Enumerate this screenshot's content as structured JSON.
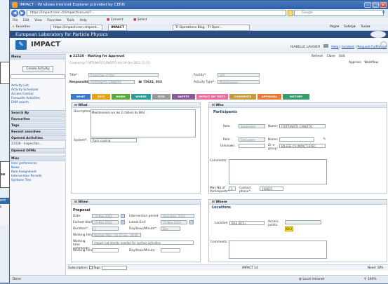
{
  "background": {
    "left_box_label": "se",
    "bottom_label": "ent fe",
    "bottom_row": "k",
    "bottom_btn": "View"
  },
  "window": {
    "title": "IMPACT - Windows Internet Explorer provided by CERN",
    "min": "–",
    "max": "□",
    "close": "✕"
  },
  "nav": {
    "back": "◀",
    "forward": "▶",
    "url": "https://impact.cern.ch/impact/secure/?...",
    "search_placeholder": "Google"
  },
  "menu": [
    "File",
    "Edit",
    "View",
    "Favorites",
    "Tools",
    "Help"
  ],
  "menu_extra": {
    "convert": "Convert",
    "select": "Select"
  },
  "favorites": {
    "label": "Favorites",
    "tab1": "https://impact.cern.ch/perd...",
    "tab2": "IMPACT",
    "tab3": "TI Operations Blog - TI Oper..."
  },
  "toolbar_right": {
    "page": "Page",
    "safety": "Safety",
    "tools": "Tools"
  },
  "banner": "European Laboratory for Particle Physics",
  "app": {
    "name": "IMPACT",
    "user": "ISABELLE LAUGIER",
    "help": "Help",
    "incident": "Incident",
    "request": "Request Fulfilment"
  },
  "sidebar": {
    "menu_title": "Menu",
    "create": "Create Activity",
    "links1": [
      "Activity List",
      "Activity Scheduler",
      "Access Control",
      "Favourite Activities",
      "EAM search"
    ],
    "search_by": "Search By",
    "favourites": "Favourites",
    "tags": "Tags",
    "recent": "Recent searches",
    "opened_act": "Opened Activities",
    "opened_item": "21528 - Inspection...",
    "opened_ofs": "Opened OFMs",
    "misc": "Misc",
    "links2": [
      "User preferences",
      "News",
      "Role Assignment",
      "Intervention Periods",
      "Systems Tree"
    ]
  },
  "activity": {
    "breadcrumb": "21528 - Waiting for Approval",
    "created": "Created by FORTUNATO CANDITO the 29-Oct-2012 11:15",
    "refresh": "Refresh",
    "clone": "Clone",
    "edit": "Edit",
    "approve": "Approve",
    "workflow": "Workflow",
    "title_lbl": "Title*:",
    "title_val": "Inspection chiller",
    "facility_lbl": "Facility*:",
    "facility_val": "SPS",
    "resp_lbl": "Responsible*:",
    "resp_val": "FORTUNATO CANDITO",
    "phone": "75622, 933",
    "acttype_lbl": "Activity Type*:",
    "acttype_val": "Maintenance",
    "collapse": "Collapse All"
  },
  "tabs": [
    {
      "label": "WHAT",
      "color": "#3c78c8"
    },
    {
      "label": "WHO",
      "color": "#e8a21a"
    },
    {
      "label": "WHEN",
      "color": "#5caa3c"
    },
    {
      "label": "WHERE",
      "color": "#2f9c98"
    },
    {
      "label": "RISK",
      "color": "#9a9a9a"
    },
    {
      "label": "SAFETY",
      "color": "#8a5a9a"
    },
    {
      "label": "IMPACT ON TESTS",
      "color": "#e86aa0"
    },
    {
      "label": "COMMENTS",
      "color": "#c89a3a"
    },
    {
      "label": "APPROVAL",
      "color": "#e87a3a"
    },
    {
      "label": "HISTORY",
      "color": "#3a9a6a"
    }
  ],
  "what": {
    "title": "What",
    "desc_lbl": "Description:",
    "desc_val": "Maintenance sur les 2 chillers du BA3 .",
    "system_lbl": "System*:",
    "system_val": "Rack cooling"
  },
  "who": {
    "title": "Who",
    "participants": "Participants",
    "role_lbl": "Role:",
    "role1": "Supervisor",
    "name_lbl": "Name:",
    "name1": "FORTUNATO CANDITO",
    "role2": "Executant",
    "unknown_lbl": "Unknown:",
    "orgrp_lbl": "Or e-group:",
    "group": "EN-EEE-CV-IMPACT-EXEC",
    "comments_lbl": "Comments:",
    "maxnb_lbl": "Max Nb of Participants*:",
    "maxnb_val": "2",
    "contact_lbl": "Contact phone*:",
    "contact_val": "168835"
  },
  "when": {
    "title": "When",
    "proposal": "Proposal",
    "date_lbl": "Date:",
    "date_val": "13-Nov-2012",
    "period_lbl": "Intervention period:",
    "period_val": "Operation_2012",
    "earliest_lbl": "Earliest Start:",
    "earliest_val": "13-Nov-2012",
    "latest_lbl": "Latest End:",
    "latest_val": "15-Nov-2012",
    "duration_lbl": "Duration*:",
    "duration_val": "3",
    "unit_lbl": "Day/Hour/Minute*:",
    "unit_val": "Day",
    "wt_lbl": "Working time*:",
    "wt_val": "Normal: Mon - Fri 07:30 - 19:00",
    "wtc_lbl": "Working time comments:",
    "wtc_val": "impact not strictly needed for surface activities",
    "wtime_lbl": "Working time:",
    "dhm_lbl": "Day/Hour/Minute:"
  },
  "where": {
    "title": "Where",
    "locations": "Locations",
    "loc_lbl": "Location:",
    "loc_val": "BA3 (873)",
    "ap_lbl": "Access points:",
    "ap_val": "BA3",
    "comments_lbl": "Comments:"
  },
  "bottom": {
    "subscription": "Subscription:",
    "tags": "Tags:",
    "need": "Need: SPS",
    "breadcrumb2": "IMPACT 14"
  },
  "status": {
    "left": "Done",
    "zone": "Local intranet",
    "zoom": "100%"
  }
}
